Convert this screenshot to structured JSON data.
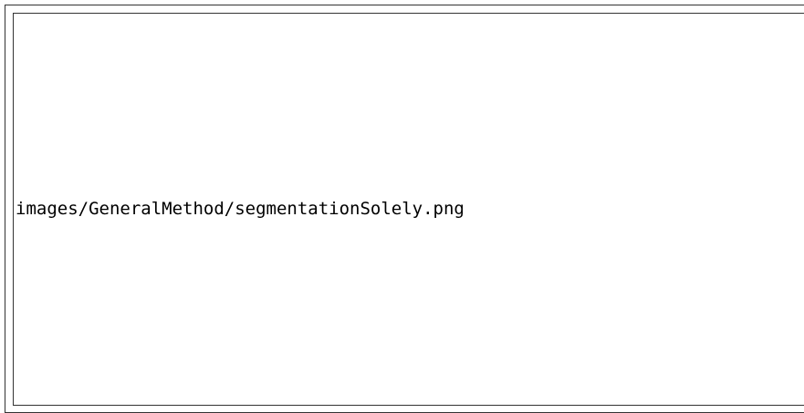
{
  "placeholder": {
    "text": "images/GeneralMethod/segmentationSolely.png"
  },
  "colors": {
    "background": "#ffffff",
    "border": "#333333",
    "text": "#000000"
  }
}
